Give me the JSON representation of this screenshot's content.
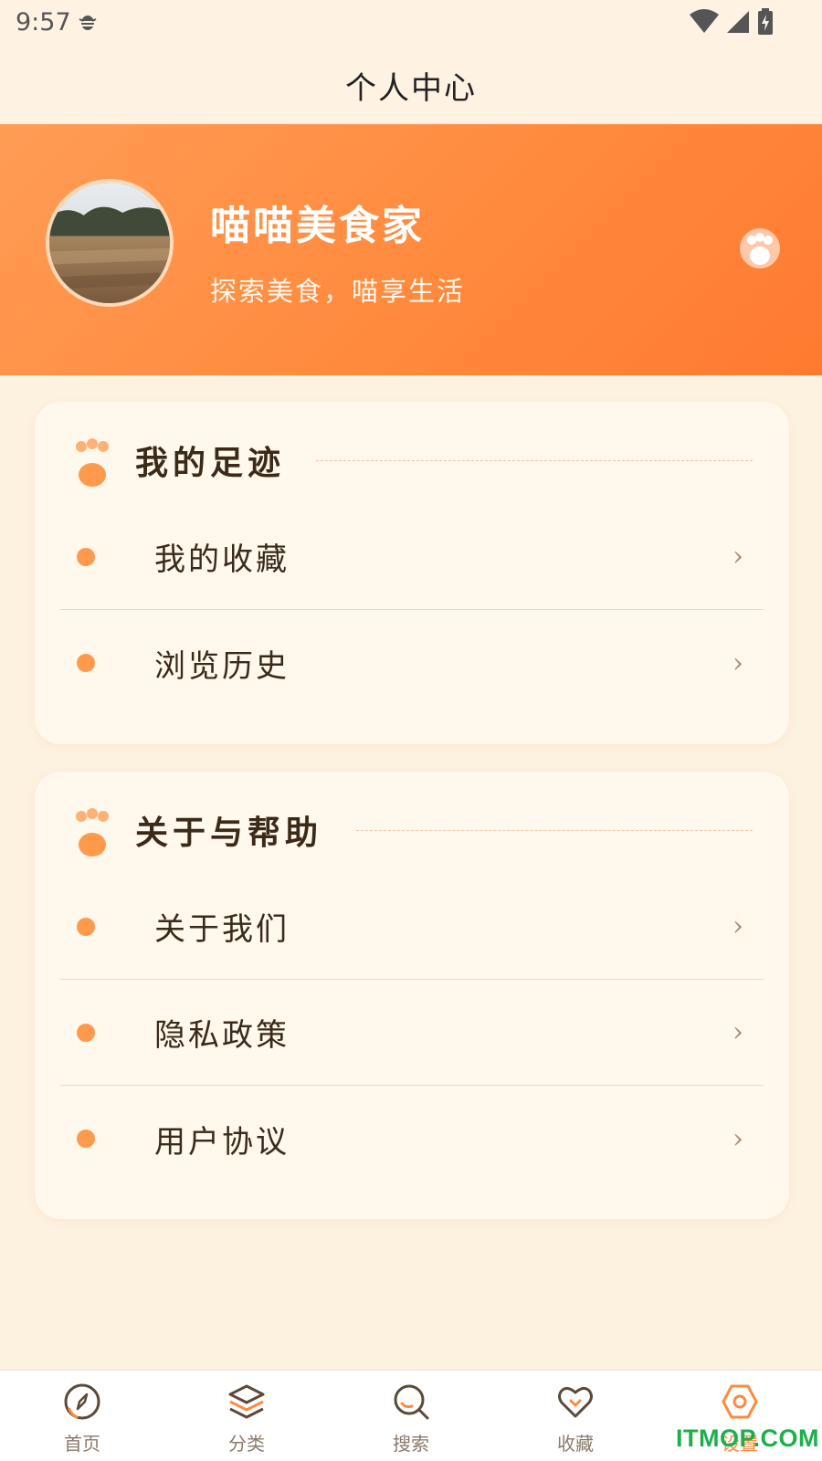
{
  "status_bar": {
    "time": "9:57"
  },
  "header": {
    "title": "个人中心"
  },
  "profile": {
    "name": "喵喵美食家",
    "slogan": "探索美食，喵享生活"
  },
  "sections": [
    {
      "title": "我的足迹",
      "items": [
        {
          "label": "我的收藏",
          "chevron": "›"
        },
        {
          "label": "浏览历史",
          "chevron": "›"
        }
      ]
    },
    {
      "title": "关于与帮助",
      "items": [
        {
          "label": "关于我们",
          "chevron": "›"
        },
        {
          "label": "隐私政策",
          "chevron": "›"
        },
        {
          "label": "用户协议",
          "chevron": "›"
        }
      ]
    }
  ],
  "bottom_nav": {
    "items": [
      {
        "label": "首页",
        "icon": "compass-icon"
      },
      {
        "label": "分类",
        "icon": "layers-icon"
      },
      {
        "label": "搜索",
        "icon": "search-icon"
      },
      {
        "label": "收藏",
        "icon": "heart-icon"
      },
      {
        "label": "设置",
        "icon": "settings-hexagon-icon",
        "active": true
      }
    ]
  },
  "watermark": "ITMOP.COM",
  "colors": {
    "accent": "#ff8a3d",
    "background": "#fdf1df",
    "card": "#fff8ec",
    "watermark": "#1bb04a"
  }
}
